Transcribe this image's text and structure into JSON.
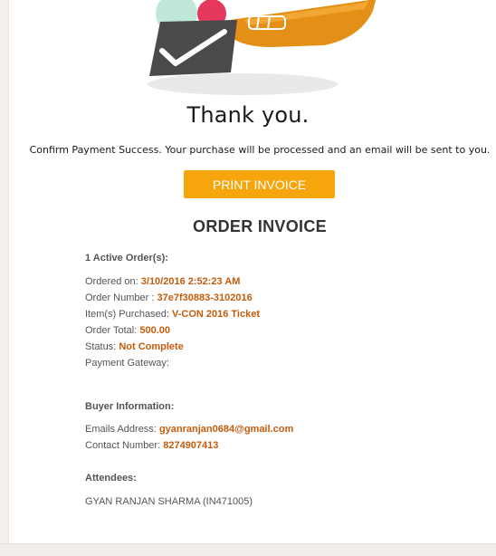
{
  "header": {
    "thank_you": "Thank you.",
    "confirm_message": "Confirm Payment Success. Your purchase will be processed and an email will be sent to you."
  },
  "actions": {
    "print_invoice": "PRINT INVOICE"
  },
  "invoice": {
    "title": "ORDER INVOICE",
    "active_orders": "1 Active Order(s):",
    "fields": [
      {
        "label": "Ordered on:",
        "value": "3/10/2016 2:52:23 AM"
      },
      {
        "label": "Order Number :",
        "value": "37e7f30883-3102016"
      },
      {
        "label": "Item(s) Purchased:",
        "value": "V-CON 2016 Ticket"
      },
      {
        "label": "Order Total:",
        "value": "500.00"
      },
      {
        "label": "Status:",
        "value": "Not Complete"
      },
      {
        "label": "Payment Gateway:",
        "value": ""
      }
    ]
  },
  "buyer": {
    "heading": "Buyer Information:",
    "email_label": "Emails Address:",
    "email_value": "gyanranjan0684@gmail.com",
    "contact_label": "Contact Number:",
    "contact_value": "8274907413"
  },
  "attendees": {
    "heading": "Attendees:",
    "names": [
      "GYAN RANJAN SHARMA (IN471005)"
    ]
  },
  "colors": {
    "accent_orange": "#f7a50c",
    "value_orange": "#c55c0d",
    "text_dark": "#1a1a1a",
    "text_muted": "#555555"
  }
}
